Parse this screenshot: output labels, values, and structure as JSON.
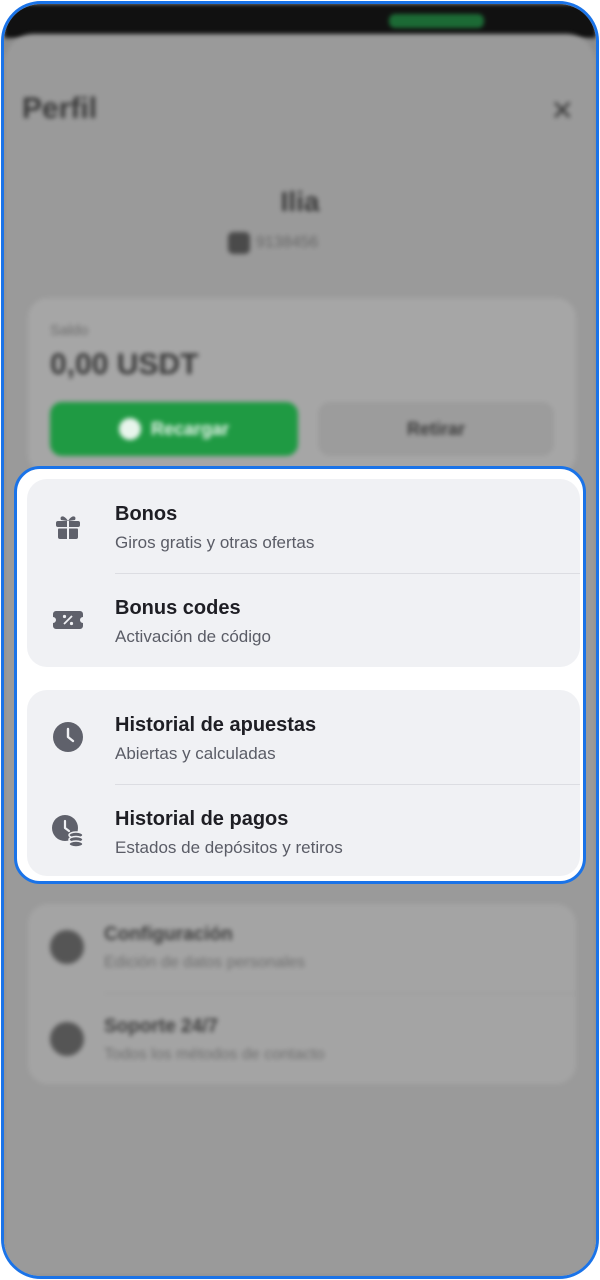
{
  "header": {
    "title": "Perfil",
    "close_glyph": "✕"
  },
  "user": {
    "name": "Ilia",
    "id": "9138456"
  },
  "balance": {
    "label": "Saldo",
    "value": "0,00 USDT",
    "deposit_label": "Recargar",
    "withdraw_label": "Retirar"
  },
  "menu_group_1": [
    {
      "title": "Bonos",
      "subtitle": "Giros gratis y otras ofertas",
      "icon": "gift-icon"
    },
    {
      "title": "Bonus codes",
      "subtitle": "Activación de código",
      "icon": "ticket-icon"
    }
  ],
  "menu_group_2": [
    {
      "title": "Historial de apuestas",
      "subtitle": "Abiertas y calculadas",
      "icon": "clock-icon"
    },
    {
      "title": "Historial de pagos",
      "subtitle": "Estados de depósitos y retiros",
      "icon": "payment-history-icon"
    }
  ],
  "menu_group_3": [
    {
      "title": "Configuración",
      "subtitle": "Edición de datos personales",
      "icon": "gear-icon"
    },
    {
      "title": "Soporte 24/7",
      "subtitle": "Todos los métodos de contacto",
      "icon": "support-icon"
    }
  ],
  "colors": {
    "highlight": "#1a73e8",
    "primary_green": "#1f9a43",
    "icon_gray": "#5f616b"
  }
}
